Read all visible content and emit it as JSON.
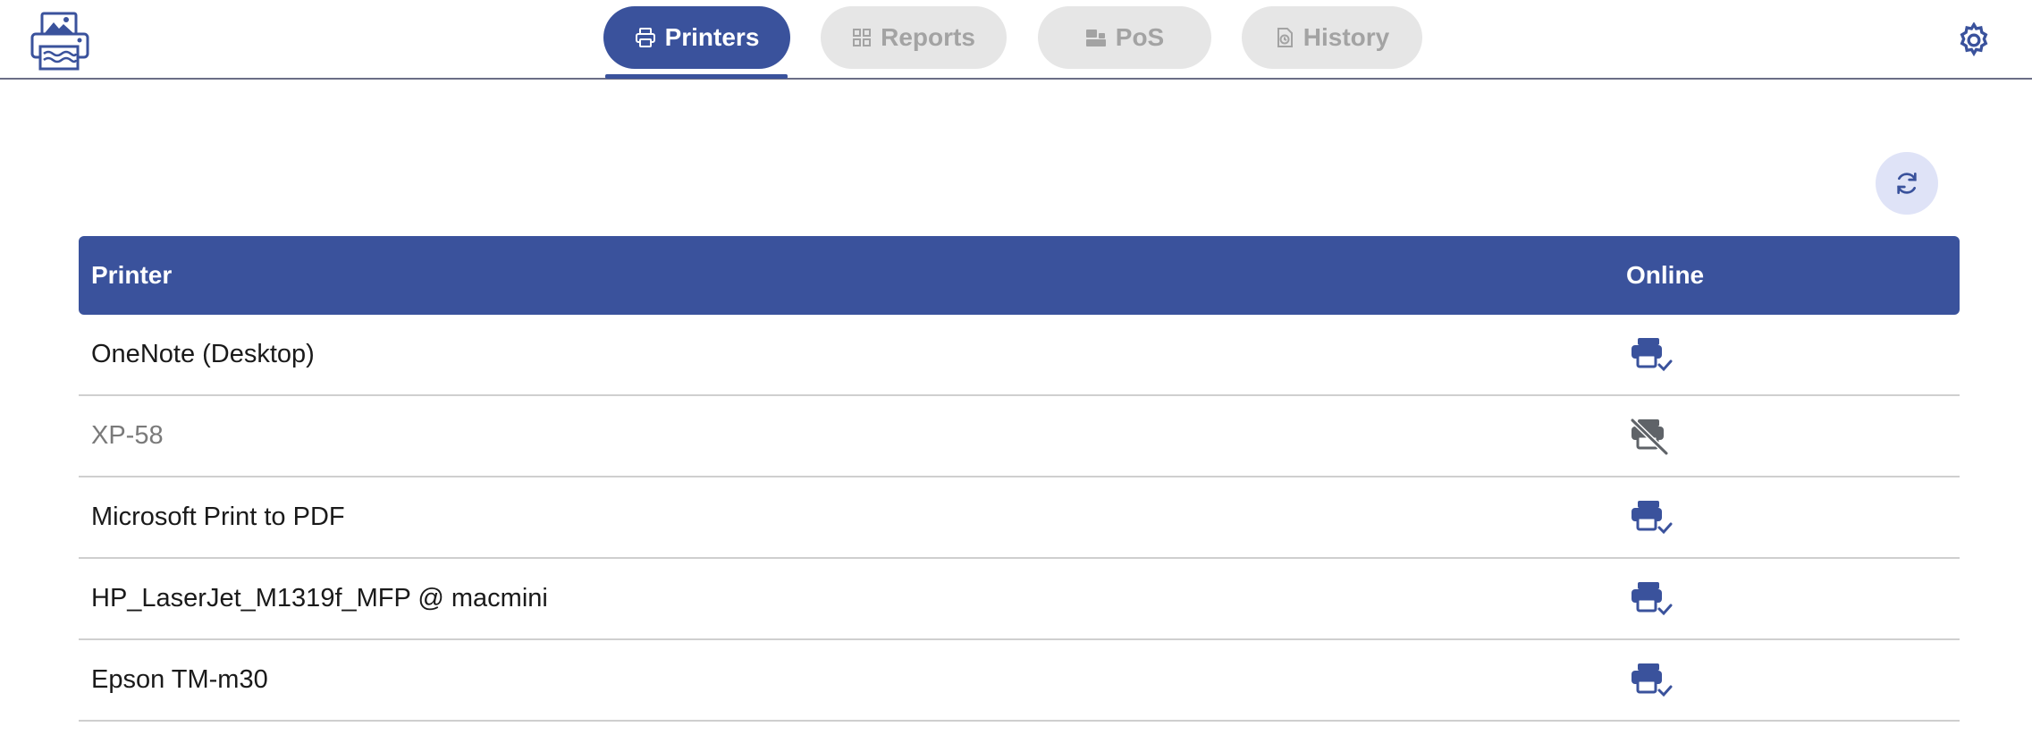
{
  "nav": {
    "tabs": [
      {
        "label": "Printers",
        "icon": "printer-icon",
        "active": true
      },
      {
        "label": "Reports",
        "icon": "reports-icon",
        "active": false
      },
      {
        "label": "PoS",
        "icon": "pos-icon",
        "active": false
      },
      {
        "label": "History",
        "icon": "history-icon",
        "active": false
      }
    ]
  },
  "colors": {
    "accent": "#3a529c",
    "inactive_tab_bg": "#e6e6e6",
    "inactive_tab_text": "#a3a3a3",
    "refresh_bg": "#dfe3f7",
    "offline_icon": "#5f6368"
  },
  "table": {
    "headers": {
      "printer": "Printer",
      "online": "Online"
    },
    "rows": [
      {
        "name": "OneNote (Desktop)",
        "online": true
      },
      {
        "name": "XP-58",
        "online": false
      },
      {
        "name": "Microsoft Print to PDF",
        "online": true
      },
      {
        "name": "HP_LaserJet_M1319f_MFP @ macmini",
        "online": true
      },
      {
        "name": "Epson TM-m30",
        "online": true
      }
    ]
  }
}
